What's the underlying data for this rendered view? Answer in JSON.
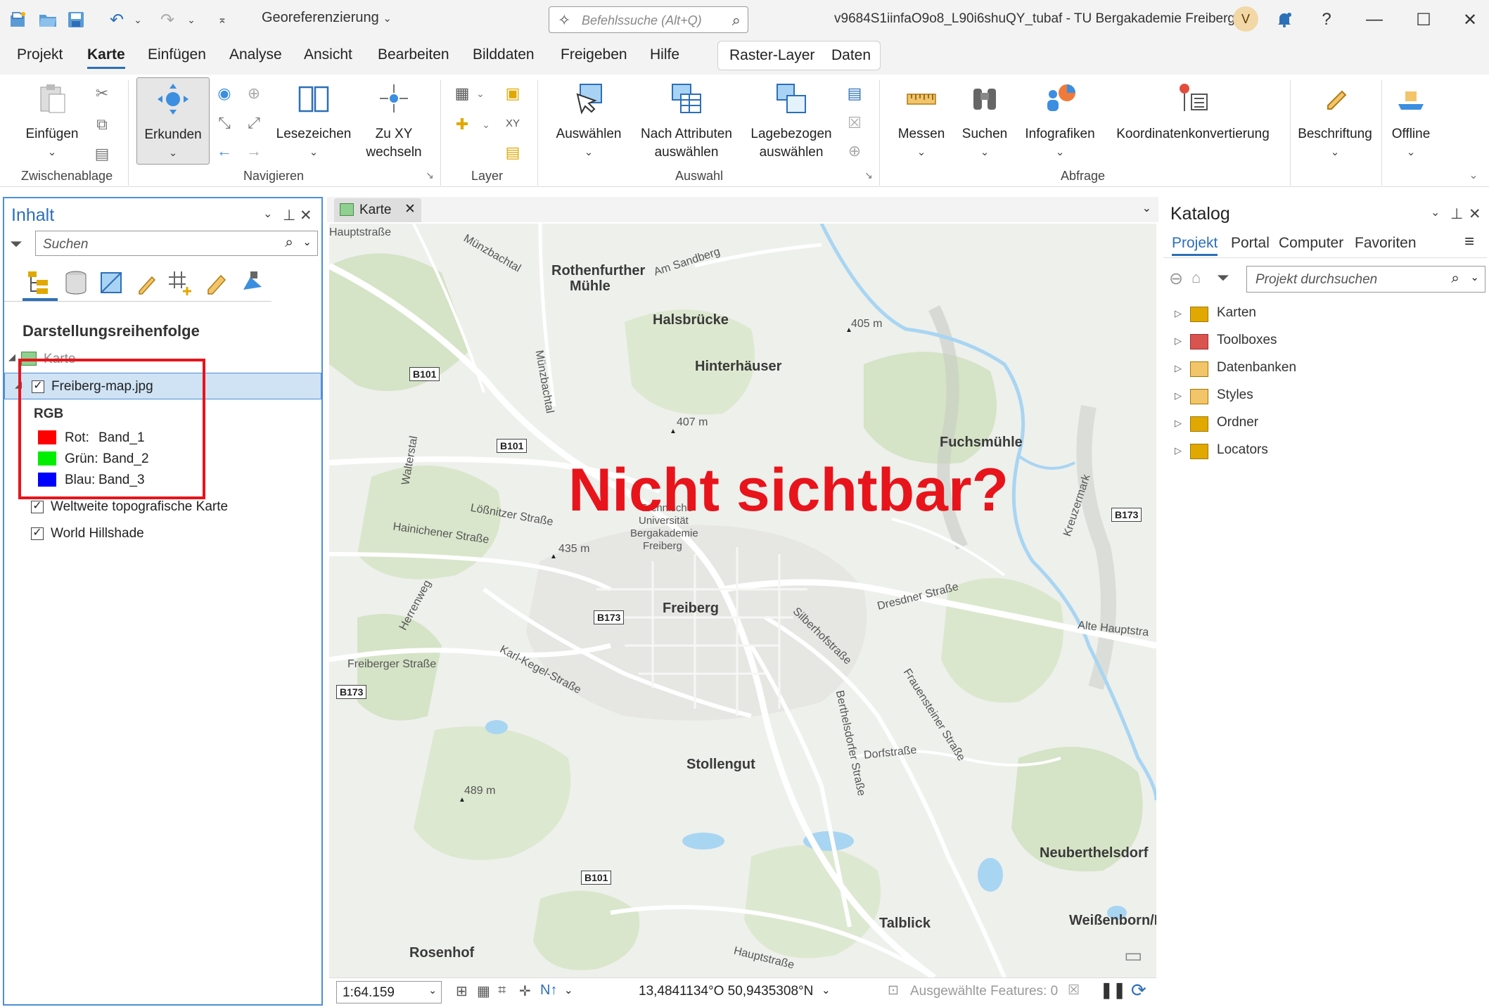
{
  "titlebar": {
    "project_dropdown": "Georeferenzierung",
    "command_search_placeholder": "Befehlssuche (Alt+Q)",
    "window_title": "v9684S1iinfaO9o8_L90i6shuQY_tubaf - TU Bergakademie Freiberg",
    "user_initial": "V"
  },
  "menu": {
    "tabs": [
      "Projekt",
      "Karte",
      "Einfügen",
      "Analyse",
      "Ansicht",
      "Bearbeiten",
      "Bilddaten",
      "Freigeben",
      "Hilfe"
    ],
    "active_tab": "Karte",
    "context_tabs": [
      "Raster-Layer",
      "Daten"
    ]
  },
  "ribbon": {
    "einfuegen": "Einfügen",
    "erkunden": "Erkunden",
    "lesezeichen": "Lesezeichen",
    "zu_xy_1": "Zu XY",
    "zu_xy_2": "wechseln",
    "auswaehlen": "Auswählen",
    "nach_attr_1": "Nach Attributen",
    "nach_attr_2": "auswählen",
    "lage_1": "Lagebezogen",
    "lage_2": "auswählen",
    "messen": "Messen",
    "suchen": "Suchen",
    "infografiken": "Infografiken",
    "koordinaten": "Koordinatenkonvertierung",
    "beschriftung": "Beschriftung",
    "offline": "Offline",
    "groups": {
      "zwischenablage": "Zwischenablage",
      "navigieren": "Navigieren",
      "layer": "Layer",
      "auswahl": "Auswahl",
      "abfrage": "Abfrage"
    }
  },
  "contents": {
    "title": "Inhalt",
    "search_placeholder": "Suchen",
    "section": "Darstellungsreihenfolge",
    "map_name": "Karte",
    "layers": [
      {
        "name": "Freiberg-map.jpg",
        "checked": true
      },
      {
        "name": "Weltweite topografische Karte",
        "checked": true
      },
      {
        "name": "World Hillshade",
        "checked": true
      }
    ],
    "rgb_label": "RGB",
    "bands": [
      {
        "channel": "Rot:",
        "band": "Band_1",
        "color": "#ff0000"
      },
      {
        "channel": "Grün:",
        "band": "Band_2",
        "color": "#00ee00"
      },
      {
        "channel": "Blau:",
        "band": "Band_3",
        "color": "#0000ff"
      }
    ]
  },
  "map": {
    "tab_label": "Karte",
    "overlay_text": "Nicht sichtbar?",
    "labels": {
      "hauptstrasse_top": "Hauptstraße",
      "muenzbachtal": "Münzbachtal",
      "rothenfurther": "Rothenfurther",
      "muehle": "Mühle",
      "am_sandberg": "Am Sandberg",
      "halsbruecke": "Halsbrücke",
      "elev_405": "405 m",
      "hinterhaeuser": "Hinterhäuser",
      "muenzbachtal2": "Münzbachtal",
      "elev_407": "407 m",
      "fuchsmuehle": "Fuchsmühle",
      "walterstal": "Walterstal",
      "kreuzermark": "Kreuzermark",
      "loessnitzer": "Lößnitzer Straße",
      "uni1": "Technische",
      "uni2": "Universität",
      "uni3": "Bergakademie",
      "uni4": "Freiberg",
      "hainichener": "Hainichener Straße",
      "elev_435": "435 m",
      "freiberg": "Freiberg",
      "dresdner": "Dresdner Straße",
      "alte_haupt": "Alte Hauptstra",
      "herrenweg": "Herrenweg",
      "silberhof": "Silberhofstraße",
      "freiberger_str": "Freiberger Straße",
      "karl_kegel": "Karl-Kegel-Straße",
      "frauenstein": "Frauensteiner Straße",
      "berthelsdorfer": "Berthelsdorfer Straße",
      "dorfstrasse": "Dorfstraße",
      "stollengut": "Stollengut",
      "elev_489": "489 m",
      "neuberthelsdorf": "Neuberthelsdorf",
      "talblick": "Talblick",
      "weissenborn": "Weißenborn/E",
      "rosenhof": "Rosenhof",
      "hauptstrasse_bottom": "Hauptstraße"
    },
    "shields": {
      "b101_a": "B101",
      "b101_b": "B101",
      "b173_a": "B173",
      "b173_b": "B173",
      "b173_c": "B173",
      "b101_c": "B101"
    }
  },
  "status": {
    "scale": "1:64.159",
    "coordinates": "13,4841134°O 50,9435308°N",
    "selected_features": "Ausgewählte Features: 0"
  },
  "catalog": {
    "title": "Katalog",
    "tabs": [
      "Projekt",
      "Portal",
      "Computer",
      "Favoriten"
    ],
    "active_tab": "Projekt",
    "search_placeholder": "Projekt durchsuchen",
    "items": [
      "Karten",
      "Toolboxes",
      "Datenbanken",
      "Styles",
      "Ordner",
      "Locators"
    ]
  },
  "colors": {
    "accent": "#2c6fb7",
    "highlight_red": "#e8141b",
    "map_bg": "#eef0ec",
    "water": "#a8d5f2",
    "forest": "#d5e3c6"
  }
}
